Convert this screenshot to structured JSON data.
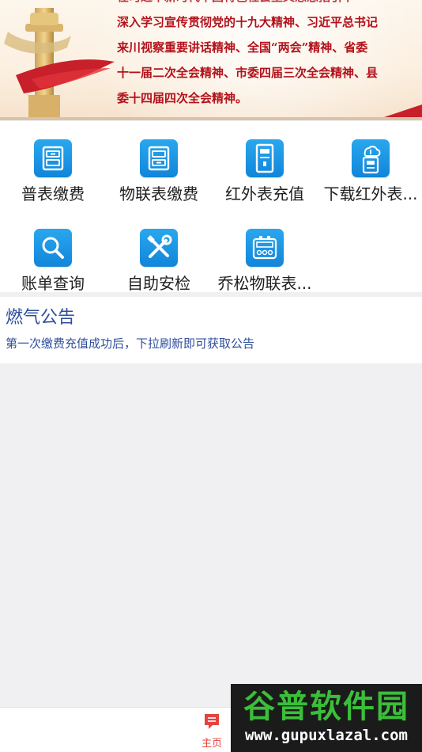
{
  "banner": {
    "lines": [
      "在习近平新时代中国特色社会主义思想指引下",
      "深入学习宣传贯彻党的十九大精神、习近平总书记",
      "来川视察重要讲话精神、全国“两会”精神、省委",
      "十一届二次全会精神、市委四届三次全会精神、县",
      "委十四届四次全会精神。"
    ]
  },
  "grid": {
    "items": [
      {
        "label": "普表缴费",
        "icon": "cabinet-icon"
      },
      {
        "label": "物联表缴费",
        "icon": "iot-meter-icon"
      },
      {
        "label": "红外表充值",
        "icon": "infrared-meter-icon"
      },
      {
        "label": "下载红外表...",
        "icon": "cloud-download-meter-icon"
      },
      {
        "label": "账单查询",
        "icon": "search-icon"
      },
      {
        "label": "自助安检",
        "icon": "tools-icon"
      },
      {
        "label": "乔松物联表...",
        "icon": "gas-meter-icon"
      }
    ]
  },
  "notice": {
    "title": "燃气公告",
    "text": "第一次缴费充值成功后，下拉刷新即可获取公告"
  },
  "nav": {
    "home_label": "主页"
  },
  "watermark": {
    "brand": "谷普软件园",
    "url": "www.gupuxlazal.com"
  },
  "colors": {
    "accent_blue": "#1a8fe3",
    "notice_blue": "#2f4f9c",
    "banner_red": "#b3121b",
    "nav_active": "#e2443f"
  }
}
